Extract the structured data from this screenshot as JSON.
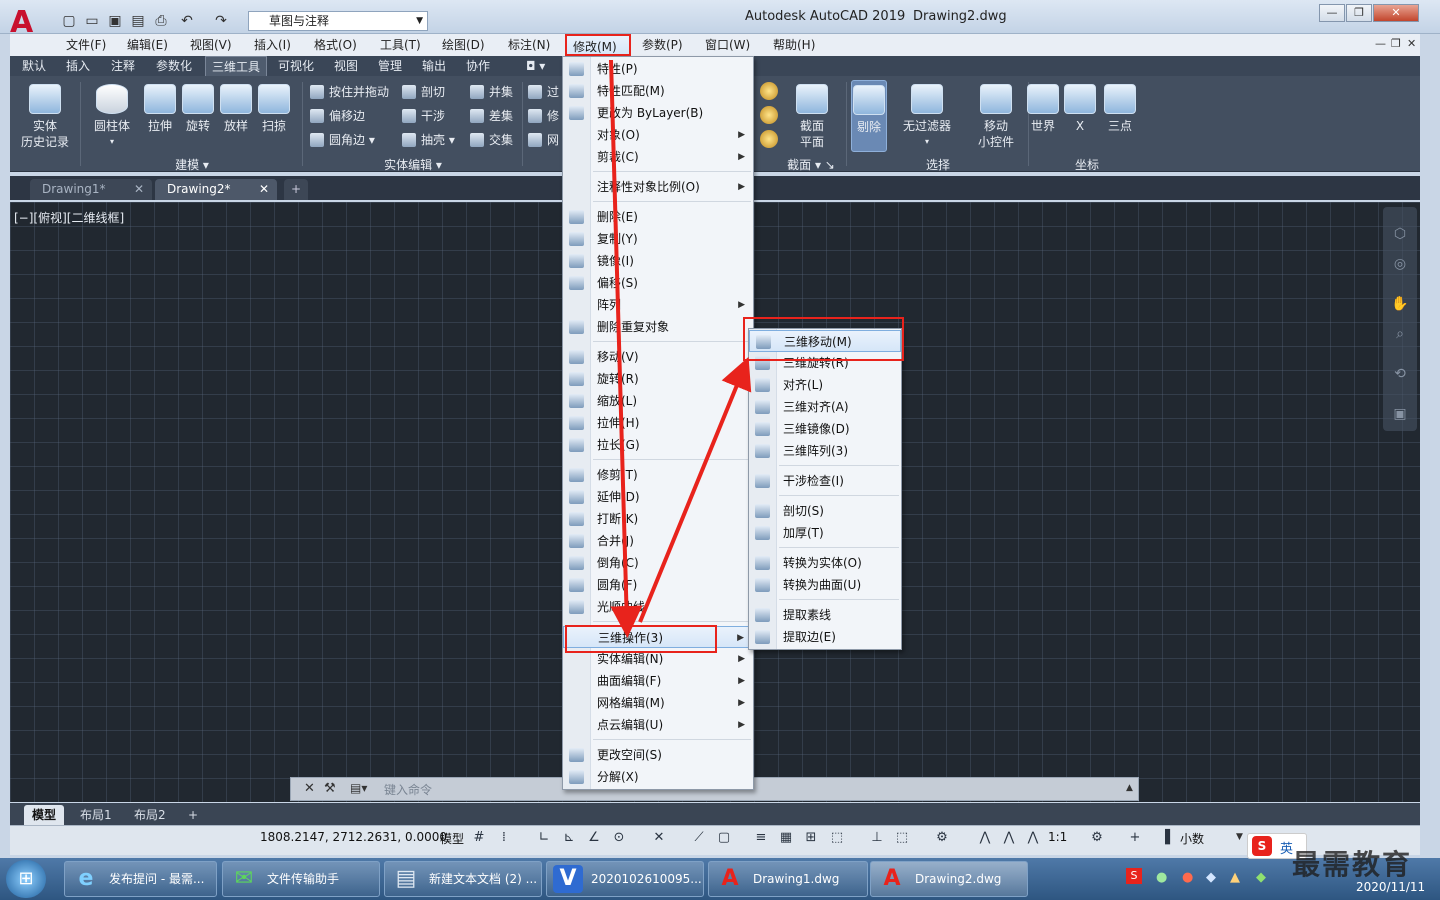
{
  "window": {
    "app_title": "Autodesk AutoCAD 2019",
    "file_name": "Drawing2.dwg",
    "workspace": "草图与注释",
    "controls": [
      "—",
      "❐",
      "✕"
    ],
    "doc_controls": [
      "—",
      "❐",
      "✕"
    ]
  },
  "menubar": [
    "文件(F)",
    "编辑(E)",
    "视图(V)",
    "插入(I)",
    "格式(O)",
    "工具(T)",
    "绘图(D)",
    "标注(N)",
    "修改(M)",
    "参数(P)",
    "窗口(W)",
    "帮助(H)"
  ],
  "ribbon_tabs": [
    "默认",
    "插入",
    "注释",
    "参数化",
    "三维工具",
    "可视化",
    "视图",
    "管理",
    "输出",
    "协作"
  ],
  "ribbon": {
    "history": {
      "line1": "实体",
      "line2": "历史记录"
    },
    "modeling_buttons": [
      "圆柱体",
      "拉伸",
      "旋转",
      "放样",
      "扫掠"
    ],
    "modeling_label": "建模",
    "solid_edit_col1": [
      "按住并拖动",
      "偏移边",
      "圆角边"
    ],
    "solid_edit_col2": [
      "剖切",
      "干涉",
      "抽壳"
    ],
    "solid_edit_col3": [
      "并集",
      "差集",
      "交集"
    ],
    "solid_edit_label": "实体编辑",
    "partial_col": [
      "过",
      "修",
      "网"
    ],
    "section_button": {
      "line1": "截面",
      "line2": "平面"
    },
    "section_label": "截面",
    "select_buttons": [
      "剔除",
      "无过滤器"
    ],
    "gizmo": {
      "line1": "移动",
      "line2": "小控件"
    },
    "select_label": "选择",
    "coord_buttons": [
      "世界",
      "X",
      "三点"
    ],
    "coord_label": "坐标"
  },
  "doc_tabs": [
    "Drawing1*",
    "Drawing2*"
  ],
  "view_label": "[−][俯视][二维线框]",
  "modify_menu": [
    {
      "label": "特性(P)",
      "icon": "properties-icon"
    },
    {
      "label": "特性匹配(M)",
      "icon": "match-properties-icon"
    },
    {
      "label": "更改为 ByLayer(B)",
      "icon": "bylayer-icon"
    },
    {
      "label": "对象(O)",
      "submenu": true
    },
    {
      "label": "剪裁(C)",
      "submenu": true
    },
    {
      "sep": true
    },
    {
      "label": "注释性对象比例(O)",
      "submenu": true
    },
    {
      "sep": true
    },
    {
      "label": "删除(E)",
      "icon": "erase-icon"
    },
    {
      "label": "复制(Y)",
      "icon": "copy-icon"
    },
    {
      "label": "镜像(I)",
      "icon": "mirror-icon"
    },
    {
      "label": "偏移(S)",
      "icon": "offset-icon"
    },
    {
      "label": "阵列",
      "submenu": true
    },
    {
      "label": "删除重复对象",
      "icon": "overkill-icon"
    },
    {
      "sep": true
    },
    {
      "label": "移动(V)",
      "icon": "move-icon"
    },
    {
      "label": "旋转(R)",
      "icon": "rotate-icon"
    },
    {
      "label": "缩放(L)",
      "icon": "scale-icon"
    },
    {
      "label": "拉伸(H)",
      "icon": "stretch-icon"
    },
    {
      "label": "拉长(G)",
      "icon": "lengthen-icon"
    },
    {
      "sep": true
    },
    {
      "label": "修剪(T)",
      "icon": "trim-icon"
    },
    {
      "label": "延伸(D)",
      "icon": "extend-icon"
    },
    {
      "label": "打断(K)",
      "icon": "break-icon"
    },
    {
      "label": "合并(J)",
      "icon": "join-icon"
    },
    {
      "label": "倒角(C)",
      "icon": "chamfer-icon"
    },
    {
      "label": "圆角(F)",
      "icon": "fillet-icon"
    },
    {
      "label": "光顺曲线",
      "icon": "blend-curves-icon"
    },
    {
      "sep": true
    },
    {
      "label": "三维操作(3)",
      "submenu": true,
      "highlight": true
    },
    {
      "label": "实体编辑(N)",
      "submenu": true
    },
    {
      "label": "曲面编辑(F)",
      "submenu": true
    },
    {
      "label": "网格编辑(M)",
      "submenu": true
    },
    {
      "label": "点云编辑(U)",
      "submenu": true
    },
    {
      "sep": true
    },
    {
      "label": "更改空间(S)",
      "icon": "change-space-icon"
    },
    {
      "label": "分解(X)",
      "icon": "explode-icon"
    }
  ],
  "submenu_3d": [
    {
      "label": "三维移动(M)",
      "icon": "3d-move-icon",
      "highlight": true
    },
    {
      "label": "三维旋转(R)",
      "icon": "3d-rotate-icon"
    },
    {
      "label": "对齐(L)",
      "icon": "align-icon"
    },
    {
      "label": "三维对齐(A)",
      "icon": "3d-align-icon"
    },
    {
      "label": "三维镜像(D)",
      "icon": "3d-mirror-icon"
    },
    {
      "label": "三维阵列(3)",
      "icon": "3d-array-icon"
    },
    {
      "sep": true
    },
    {
      "label": "干涉检查(I)",
      "icon": "interference-icon"
    },
    {
      "sep": true
    },
    {
      "label": "剖切(S)",
      "icon": "slice-icon"
    },
    {
      "label": "加厚(T)",
      "icon": "thicken-icon"
    },
    {
      "sep": true
    },
    {
      "label": "转换为实体(O)",
      "icon": "convert-to-solid-icon"
    },
    {
      "label": "转换为曲面(U)",
      "icon": "convert-to-surface-icon"
    },
    {
      "sep": true
    },
    {
      "label": "提取素线",
      "icon": "extract-isolines-icon"
    },
    {
      "label": "提取边(E)",
      "icon": "extract-edges-icon"
    }
  ],
  "command_line": {
    "placeholder": "键入命令"
  },
  "layout_tabs": [
    "模型",
    "布局1",
    "布局2"
  ],
  "status": {
    "coords": "1808.2147, 2712.2631, 0.0000",
    "model": "模型",
    "scale": "1:1",
    "units": "小数"
  },
  "taskbar": {
    "items": [
      "发布提问 - 最需...",
      "文件传输助手",
      "新建文本文档 (2) ...",
      "2020102610095...",
      "Drawing1.dwg",
      "Drawing2.dwg"
    ],
    "date": "2020/11/11"
  },
  "watermark": "最需教育",
  "ime_label": "英",
  "colors": {
    "accent_red": "#e8231c",
    "canvas": "#212830",
    "ribbon": "#434f60",
    "highlight": "#d6e6f8"
  }
}
